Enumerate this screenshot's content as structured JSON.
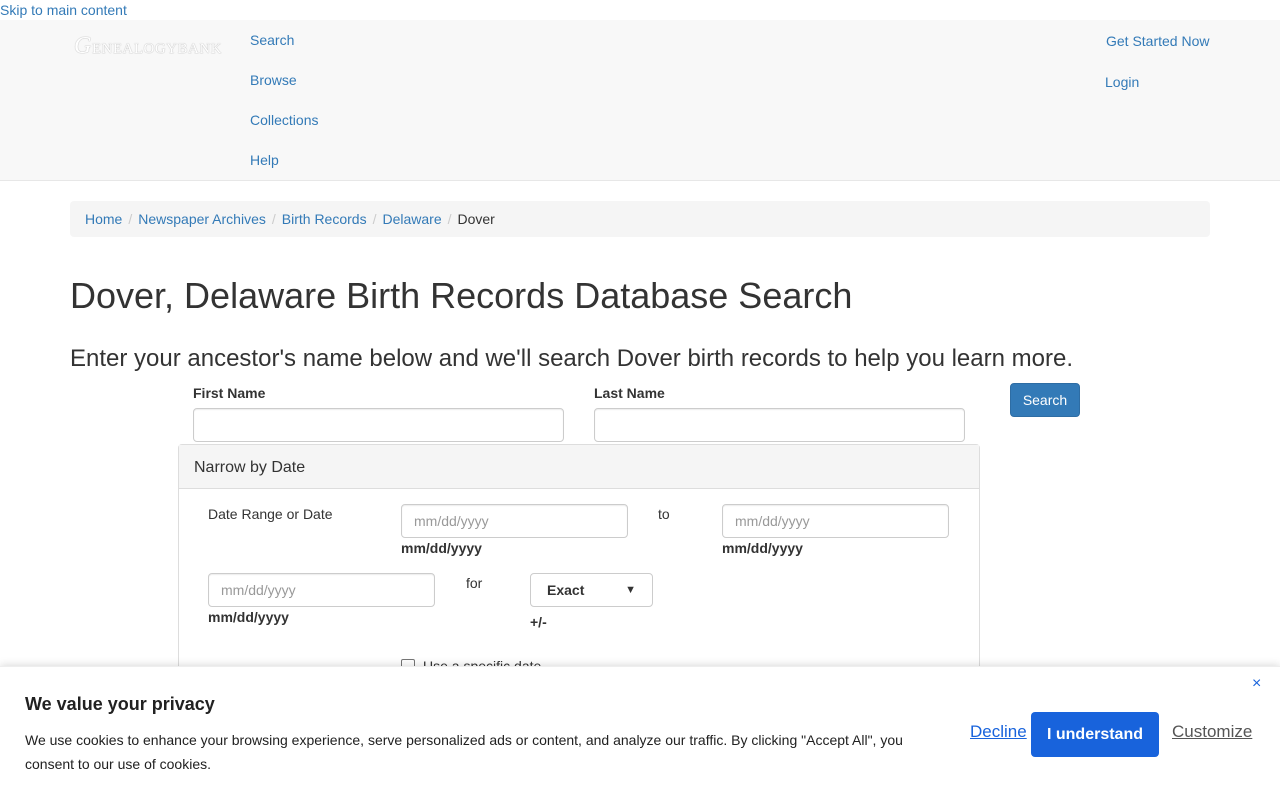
{
  "skip_link": "Skip to main content",
  "logo": {
    "initial": "G",
    "rest": "ENEALOGYBANK"
  },
  "nav": {
    "left": [
      "Search",
      "Browse",
      "Collections",
      "Help"
    ],
    "right": [
      "Get Started Now",
      "Login"
    ]
  },
  "breadcrumb": [
    "Home",
    "Newspaper Archives",
    "Birth Records",
    "Delaware",
    "Dover"
  ],
  "page_title": "Dover, Delaware Birth Records Database Search",
  "subtitle": "Enter your ancestor's name below and we'll search Dover birth records to help you learn more.",
  "search_form": {
    "first_name_label": "First Name",
    "first_name_value": "",
    "last_name_label": "Last Name",
    "last_name_value": "",
    "search_button": "Search"
  },
  "narrow_by_date": {
    "heading": "Narrow by Date",
    "date_range_label": "Date Range or Date",
    "date_placeholder": "mm/dd/yyyy",
    "date_hint": "mm/dd/yyyy",
    "to_label": "to",
    "for_label": "for",
    "exact_selected": "Exact",
    "plus_minus": "+/-",
    "specific_date_label": "Use a specific date"
  },
  "cookie_banner": {
    "title": "We value your privacy",
    "text": "We use cookies to enhance your browsing experience, serve personalized ads or content, and analyze our traffic. By clicking \"Accept All\", you consent to our use of cookies.",
    "decline": "Decline",
    "accept": "I understand",
    "customize": "Customize",
    "close": "×"
  },
  "colors": {
    "link": "#337ab7",
    "button_primary": "#337ab7",
    "cookie_accent": "#1863dc"
  }
}
